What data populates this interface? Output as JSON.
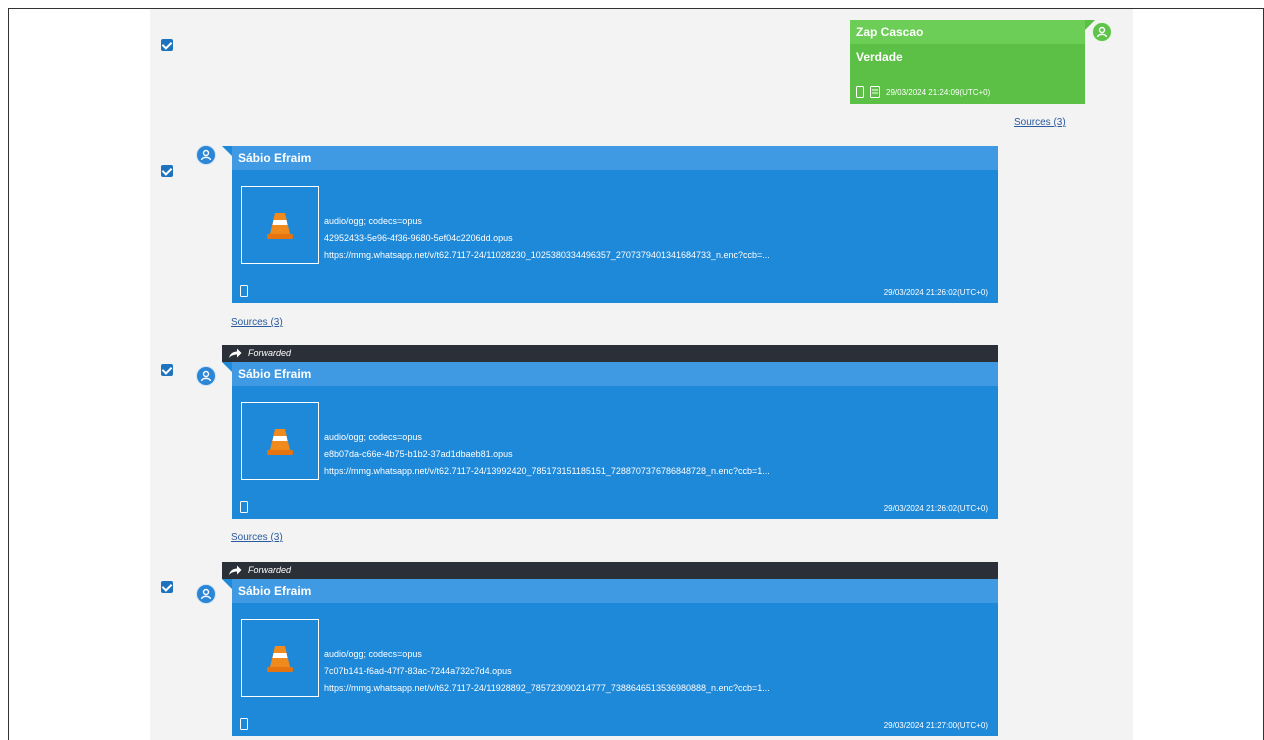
{
  "outgoing": {
    "sender": "Zap Cascao",
    "text": "Verdade",
    "timestamp": "29/03/2024 21:24:09(UTC+0)",
    "sources": "Sources (3)"
  },
  "messages": [
    {
      "forwarded": false,
      "sender": "Sábio Efraim",
      "mime": "audio/ogg; codecs=opus",
      "file": "42952433-5e96-4f36-9680-5ef04c2206dd.opus",
      "url": "https://mmg.whatsapp.net/v/t62.7117-24/11028230_1025380334496357_2707379401341684733_n.enc?ccb=...",
      "timestamp": "29/03/2024 21:26:02(UTC+0)",
      "sources": "Sources (3)"
    },
    {
      "forwarded": true,
      "forwarded_label": "Forwarded",
      "sender": "Sábio Efraim",
      "mime": "audio/ogg; codecs=opus",
      "file": "e8b07da-c66e-4b75-b1b2-37ad1dbaeb81.opus",
      "url": "https://mmg.whatsapp.net/v/t62.7117-24/13992420_785173151185151_7288707376786848728_n.enc?ccb=1...",
      "timestamp": "29/03/2024 21:26:02(UTC+0)",
      "sources": "Sources (3)"
    },
    {
      "forwarded": true,
      "forwarded_label": "Forwarded",
      "sender": "Sábio Efraim",
      "mime": "audio/ogg; codecs=opus",
      "file": "7c07b141-f6ad-47f7-83ac-7244a732c7d4.opus",
      "url": "https://mmg.whatsapp.net/v/t62.7117-24/11928892_785723090214777_7388646513536980888_n.enc?ccb=1...",
      "timestamp": "29/03/2024 21:27:00(UTC+0)"
    }
  ],
  "colors": {
    "outgoing_bubble": "#5cc046",
    "incoming_bubble": "#1e88d9",
    "forwarded_bar": "#2a2f38",
    "checkbox": "#1e73be"
  }
}
